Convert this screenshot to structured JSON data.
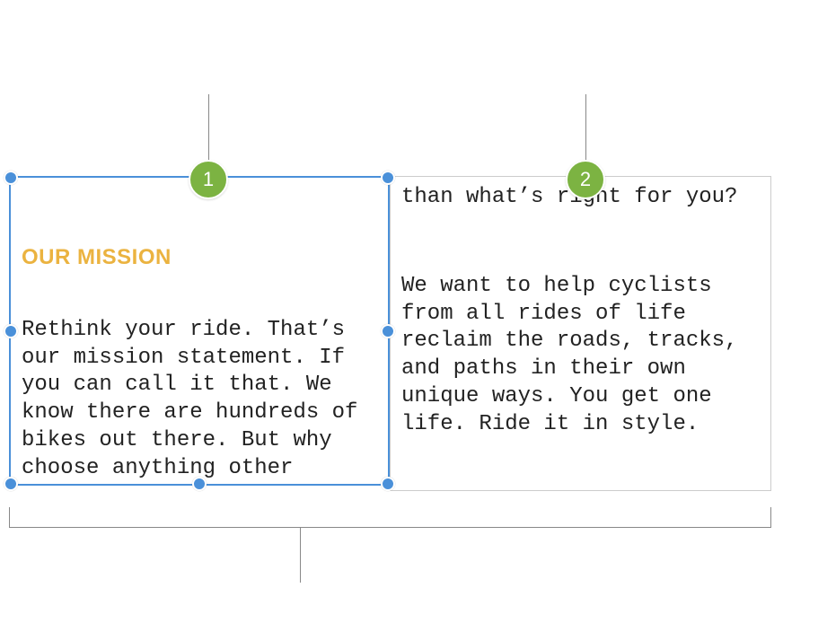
{
  "callouts": {
    "badge1": "1",
    "badge2": "2"
  },
  "mission": {
    "heading": "OUR MISSION",
    "col1": "Rethink your ride. That’s our mission statement. If you can call it that. We know there are hundreds of bikes out there. But why choose anything other",
    "col2_top": "than what’s right for you?",
    "col2_bottom": "We want to help cyclists from all rides of life reclaim the roads, tracks, and paths in their own unique ways. You get one life. Ride it in style."
  }
}
